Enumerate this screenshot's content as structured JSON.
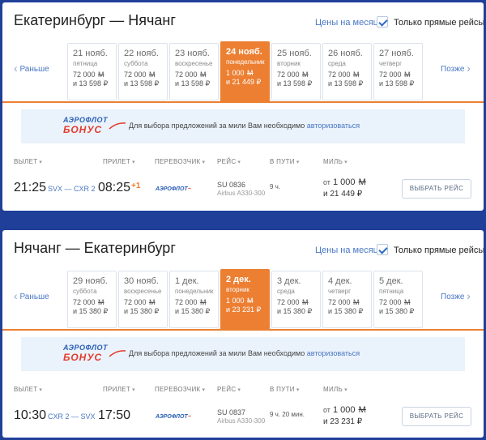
{
  "routes": [
    {
      "title": "Екатеринбург — Нячанг",
      "month_link": "Цены на месяц",
      "direct_label": "Только прямые рейсы",
      "prev": "Раньше",
      "next": "Позже",
      "dates": [
        {
          "date": "21 нояб.",
          "day": "пятница",
          "miles": "72 000",
          "rub": "и 13 598 ₽"
        },
        {
          "date": "22 нояб.",
          "day": "суббота",
          "miles": "72 000",
          "rub": "и 13 598 ₽"
        },
        {
          "date": "23 нояб.",
          "day": "воскресенье",
          "miles": "72 000",
          "rub": "и 13 598 ₽"
        },
        {
          "date": "24 нояб.",
          "day": "понедельник",
          "miles": "1 000",
          "rub": "и 21 449 ₽"
        },
        {
          "date": "25 нояб.",
          "day": "вторник",
          "miles": "72 000",
          "rub": "и 13 598 ₽"
        },
        {
          "date": "26 нояб.",
          "day": "среда",
          "miles": "72 000",
          "rub": "и 13 598 ₽"
        },
        {
          "date": "27 нояб.",
          "day": "четверг",
          "miles": "72 000",
          "rub": "и 13 598 ₽"
        }
      ],
      "promo": {
        "logo_top": "АЭРОФЛОТ",
        "logo_bottom": "БОНУС",
        "text": "Для выбора предложений за мили Вам необходимо ",
        "link": "авторизоваться"
      },
      "headers": {
        "depart": "ВЫЛЕТ",
        "arrive": "ПРИЛЕТ",
        "carrier": "ПЕРЕВОЗЧИК",
        "flight": "РЕЙС",
        "duration": "В ПУТИ",
        "miles": "МИЛЬ"
      },
      "flight": {
        "depart_time": "21:25",
        "airports": "SVX — CXR 2",
        "arrive_time": "08:25",
        "plus_days": "+1",
        "carrier_logo": "АЭРОФЛОТ",
        "flight_no": "SU 0836",
        "aircraft": "Airbus A330-300",
        "duration": "9 ч.",
        "price_from": "от",
        "price_miles": "1 000",
        "price_rub": "и 21 449 ₽",
        "button": "ВЫБРАТЬ РЕЙС"
      }
    },
    {
      "title": "Нячанг — Екатеринбург",
      "month_link": "Цены на месяц",
      "direct_label": "Только прямые рейсы",
      "prev": "Раньше",
      "next": "Позже",
      "dates": [
        {
          "date": "29 нояб.",
          "day": "суббота",
          "miles": "72 000",
          "rub": "и 15 380 ₽"
        },
        {
          "date": "30 нояб.",
          "day": "воскресенье",
          "miles": "72 000",
          "rub": "и 15 380 ₽"
        },
        {
          "date": "1 дек.",
          "day": "понедельник",
          "miles": "72 000",
          "rub": "и 15 380 ₽"
        },
        {
          "date": "2 дек.",
          "day": "вторник",
          "miles": "1 000",
          "rub": "и 23 231 ₽"
        },
        {
          "date": "3 дек.",
          "day": "среда",
          "miles": "72 000",
          "rub": "и 15 380 ₽"
        },
        {
          "date": "4 дек.",
          "day": "четверг",
          "miles": "72 000",
          "rub": "и 15 380 ₽"
        },
        {
          "date": "5 дек.",
          "day": "пятница",
          "miles": "72 000",
          "rub": "и 15 380 ₽"
        }
      ],
      "promo": {
        "logo_top": "АЭРОФЛОТ",
        "logo_bottom": "БОНУС",
        "text": "Для выбора предложений за мили Вам необходимо ",
        "link": "авторизоваться"
      },
      "headers": {
        "depart": "ВЫЛЕТ",
        "arrive": "ПРИЛЕТ",
        "carrier": "ПЕРЕВОЗЧИК",
        "flight": "РЕЙС",
        "duration": "В ПУТИ",
        "miles": "МИЛЬ"
      },
      "flight": {
        "depart_time": "10:30",
        "airports": "CXR 2 — SVX",
        "arrive_time": "17:50",
        "plus_days": "",
        "carrier_logo": "АЭРОФЛОТ",
        "flight_no": "SU 0837",
        "aircraft": "Airbus A330-300",
        "duration": "9 ч. 20 мин.",
        "price_from": "от",
        "price_miles": "1 000",
        "price_rub": "и 23 231 ₽",
        "button": "ВЫБРАТЬ РЕЙС"
      }
    }
  ],
  "selected_date_index": 3,
  "mile_symbol": "М",
  "colors": {
    "background": "#1f3f99",
    "accent": "#ec7f32",
    "link": "#4a77c4",
    "promo_bg": "#eaf2fb"
  }
}
